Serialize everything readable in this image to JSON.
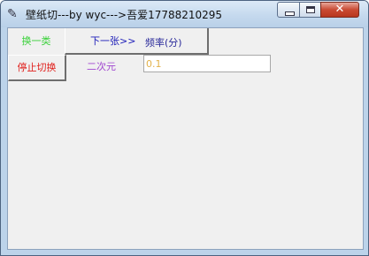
{
  "window": {
    "title": "壁纸切---by wyc--->吾爱17788210295",
    "icon": "feather-icon",
    "controls": {
      "minimize": "minimize",
      "maximize": "maximize",
      "close": "✕"
    }
  },
  "toolbar": {
    "switch_category_label": "换一类",
    "next_label": "下一张>>",
    "stop_label": "停止切换"
  },
  "labels": {
    "frequency": "频率(分)",
    "category": "二次元"
  },
  "frequency_input": {
    "value": "0.1",
    "placeholder": ""
  },
  "colors": {
    "switch_text": "#3bd13b",
    "next_text": "#1a1ab8",
    "stop_text": "#e0201c",
    "category_text": "#a046d0",
    "input_text": "#e3b24a"
  }
}
